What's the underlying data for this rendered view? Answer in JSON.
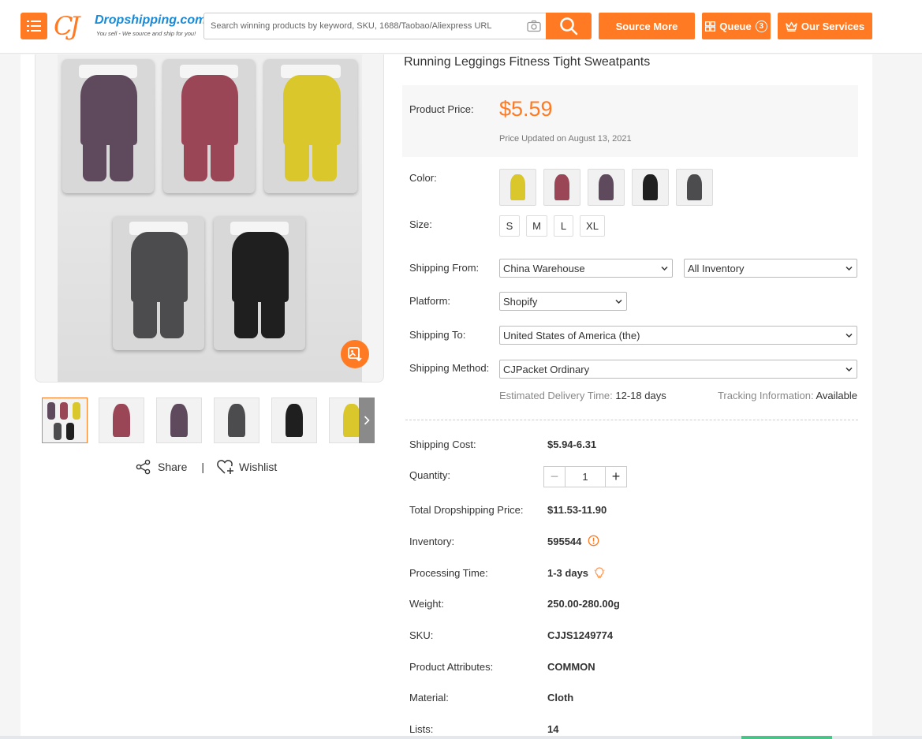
{
  "header": {
    "logo_mark": "CJ",
    "logo_site": "Dropshipping.com",
    "logo_tagline": "You sell - We source and ship for you!",
    "search_placeholder": "Search winning products by keyword, SKU, 1688/Taobao/Aliexpress URL",
    "source_more_label": "Source More",
    "queue_label": "Queue",
    "queue_count": "3",
    "services_label": "Our Services",
    "accent_color": "#ff7a22"
  },
  "gallery": {
    "share_label": "Share",
    "separator": "|",
    "wishlist_label": "Wishlist",
    "tiles": [
      {
        "color": "#5e4a5c"
      },
      {
        "color": "#9a4657"
      },
      {
        "color": "#d9c72b"
      },
      {
        "color": "#4c4c4e"
      },
      {
        "color": "#1f1f1f"
      }
    ],
    "thumbs": [
      {
        "color": "#6a5a6a",
        "active": true
      },
      {
        "color": "#9a4657"
      },
      {
        "color": "#5e4a5c"
      },
      {
        "color": "#4c4c4e"
      },
      {
        "color": "#1f1f1f"
      },
      {
        "color": "#d9c72b"
      }
    ]
  },
  "product": {
    "title": "Running Leggings Fitness Tight Sweatpants",
    "price_label": "Product Price:",
    "price": "$5.59",
    "price_updated": "Price Updated on August 13, 2021",
    "color_label": "Color:",
    "swatches": [
      "#d9c72b",
      "#9a4657",
      "#5e4a5c",
      "#1f1f1f",
      "#4c4c4e"
    ],
    "size_label": "Size:",
    "sizes": [
      "S",
      "M",
      "L",
      "XL"
    ],
    "shipping_from_label": "Shipping From:",
    "shipping_from_value": "China Warehouse",
    "inventory_filter_value": "All Inventory",
    "platform_label": "Platform:",
    "platform_value": "Shopify",
    "shipping_to_label": "Shipping To:",
    "shipping_to_value": "United States of America (the)",
    "shipping_method_label": "Shipping Method:",
    "shipping_method_value": "CJPacket Ordinary",
    "est_delivery_label": "Estimated Delivery Time:",
    "est_delivery_value": "12-18 days",
    "tracking_label": "Tracking Information:",
    "tracking_value": "Available",
    "shipping_cost_label": "Shipping Cost:",
    "shipping_cost_value": "$5.94-6.31",
    "quantity_label": "Quantity:",
    "quantity_value": "1",
    "minus": "−",
    "plus": "+",
    "total_label": "Total Dropshipping Price:",
    "total_value": "$11.53-11.90",
    "inventory_label": "Inventory:",
    "inventory_value": "595544",
    "processing_label": "Processing Time:",
    "processing_value": "1-3 days",
    "weight_label": "Weight:",
    "weight_value": "250.00-280.00g",
    "sku_label": "SKU:",
    "sku_value": "CJJS1249774",
    "attributes_label": "Product Attributes:",
    "attributes_value": "COMMON",
    "material_label": "Material:",
    "material_value": "Cloth",
    "lists_label": "Lists:",
    "lists_value": "14"
  }
}
